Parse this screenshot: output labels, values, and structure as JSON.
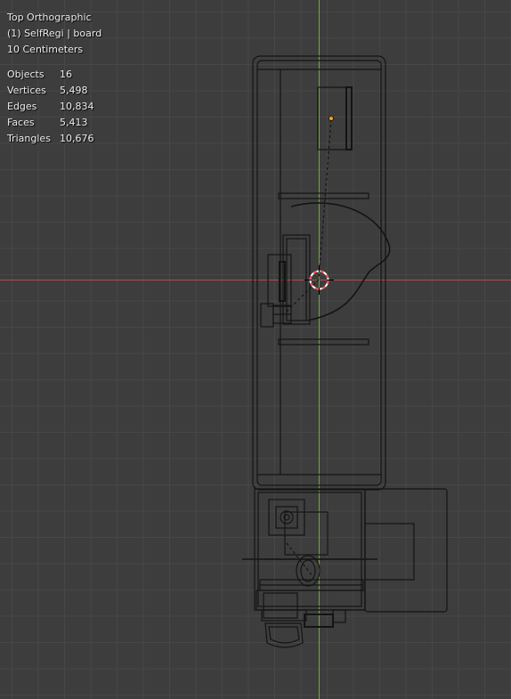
{
  "viewport": {
    "view_name": "Top Orthographic",
    "active_object": "(1) SelfRegi | board",
    "grid_scale": "10 Centimeters"
  },
  "stats": [
    {
      "label": "Objects",
      "value": "16"
    },
    {
      "label": "Vertices",
      "value": "5,498"
    },
    {
      "label": "Edges",
      "value": "10,834"
    },
    {
      "label": "Faces",
      "value": "5,413"
    },
    {
      "label": "Triangles",
      "value": "10,676"
    }
  ],
  "colors": {
    "background": "#3d3d3d",
    "grid": "#474747",
    "x_axis": "#b34a55",
    "y_axis": "#76a836",
    "wireframe": "#141414",
    "origin_dot": "#ff9a1f",
    "cursor": "#ff4d4d"
  }
}
